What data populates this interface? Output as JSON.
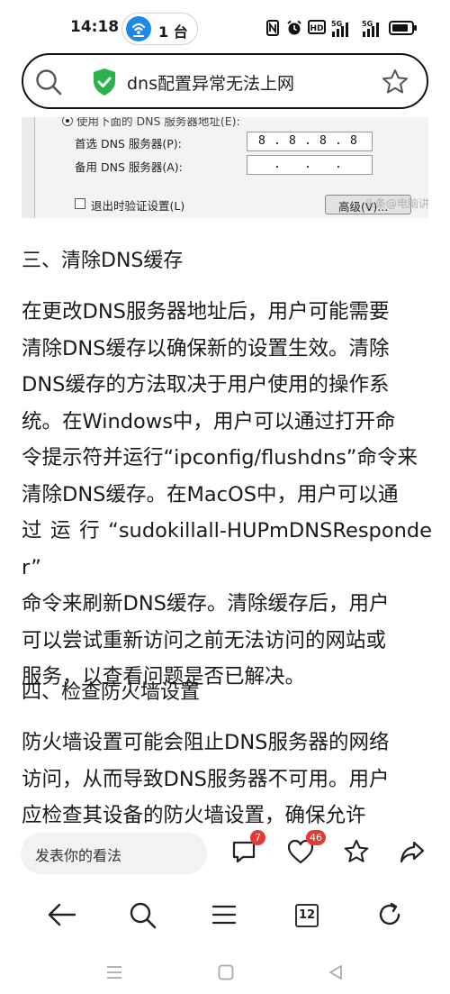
{
  "status_bar": {
    "time": "14:18",
    "hotspot_devices": "1 台",
    "network_1": "5G",
    "network_2": "5G"
  },
  "search": {
    "query": "dns配置异常无法上网"
  },
  "article": {
    "image": {
      "top_text": "使用下面的 DNS 服务器地址(E):",
      "preferred_label": "首选 DNS 服务器(P):",
      "preferred_octets": [
        "8",
        "8",
        "8",
        "8"
      ],
      "alternate_label": "备用 DNS 服务器(A):",
      "validate_label": "退出时验证设置(L)",
      "advanced_button": "高级(V)...",
      "watermark": "头条@电脑讲解"
    },
    "section3_heading": "三、清除DNS缓存",
    "section3_lines": [
      "在更改DNS服务器地址后，用户可能需要",
      "清除DNS缓存以确保新的设置生效。清除",
      "DNS缓存的方法取决于用户使用的操作系",
      "统。在Windows中，用户可以通过打开命",
      "令提示符并运行“ipconfig/flushdns”命令来",
      "清除DNS缓存。在MacOS中，用户可以通",
      "过 运 行 “sudokillall-HUPmDNSResponder”",
      "命令来刷新DNS缓存。清除缓存后，用户",
      "可以尝试重新访问之前无法访问的网站或",
      "服务，以查看问题是否已解决。"
    ],
    "section4_heading": "四、检查防火墙设置",
    "section4_lines": [
      "防火墙设置可能会阻止DNS服务器的网络",
      "访问，从而导致DNS服务器不可用。用户",
      "应检查其设备的防火墙设置，确保允许"
    ]
  },
  "comment_bar": {
    "placeholder": "发表你的看法",
    "comment_count": "7",
    "like_count": "46"
  },
  "toolbar": {
    "tab_count": "12"
  },
  "colors": {
    "shield_green": "#2bb24c",
    "hotspot_blue": "#1e88e5",
    "badge_red": "#e53935"
  }
}
